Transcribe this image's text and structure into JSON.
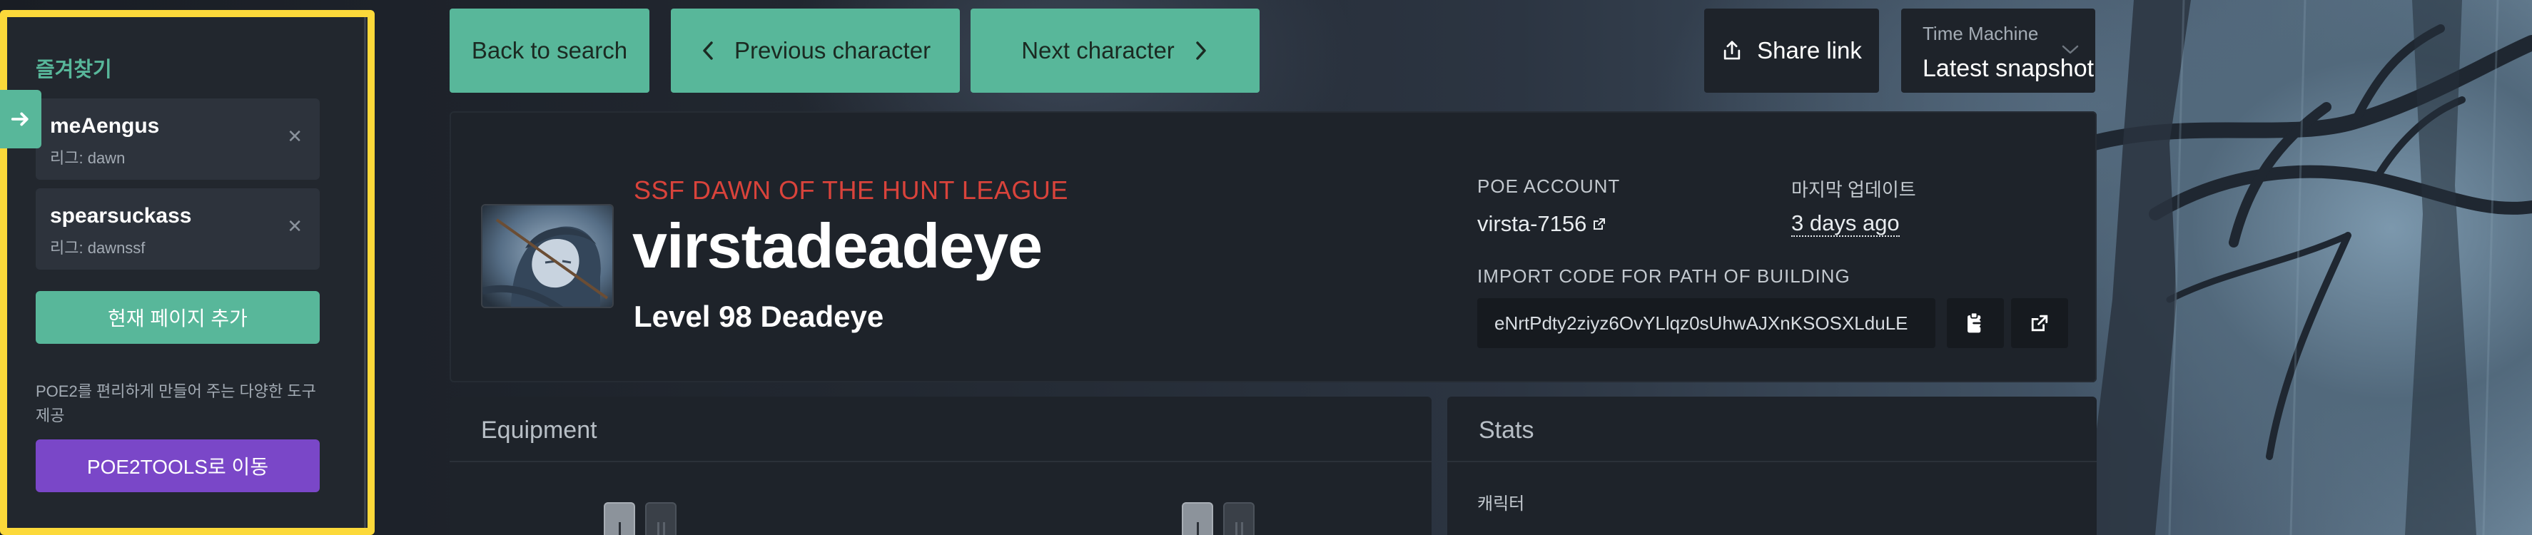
{
  "sidebar": {
    "title": "즐겨찾기",
    "favorites": [
      {
        "name": "meAengus",
        "league": "리그: dawn"
      },
      {
        "name": "spearsuckass",
        "league": "리그: dawnssf"
      }
    ],
    "add_current_page_label": "현재 페이지 추가",
    "description": "POE2를 편리하게 만들어 주는 다양한 도구 제공",
    "tools_button_label": "POE2TOOLS로 이동",
    "accent_color": "#58b79a",
    "tools_color": "#7a47c8",
    "highlight_border_color": "#fcd93a"
  },
  "toolbar": {
    "back_label": "Back to search",
    "prev_label": "Previous character",
    "next_label": "Next character",
    "share_label": "Share link",
    "time_machine": {
      "label": "Time Machine",
      "value": "Latest snapshot"
    }
  },
  "character": {
    "league": "SSF DAWN OF THE HUNT LEAGUE",
    "name": "virstadeadeye",
    "level_class": "Level 98 Deadeye",
    "account_label": "POE ACCOUNT",
    "account_value": "virsta-7156",
    "updated_label": "마지막 업데이트",
    "updated_value": "3 days ago",
    "import_label": "IMPORT CODE FOR PATH OF BUILDING",
    "import_code": "eNrtPdty2ziyz6OvYLlqz0sUhwAJXnKSOSXLduLE"
  },
  "panels": {
    "equipment_title": "Equipment",
    "stats_title": "Stats",
    "stats_subtitle": "캐릭터"
  },
  "icons": {
    "sidebar_toggle": "arrow-right-icon",
    "share": "share-icon",
    "prev": "chevron-left-icon",
    "next": "chevron-right-icon",
    "time_machine": "chevron-down-icon",
    "external_link": "external-link-icon",
    "copy": "clipboard-icon",
    "close": "close-icon"
  }
}
